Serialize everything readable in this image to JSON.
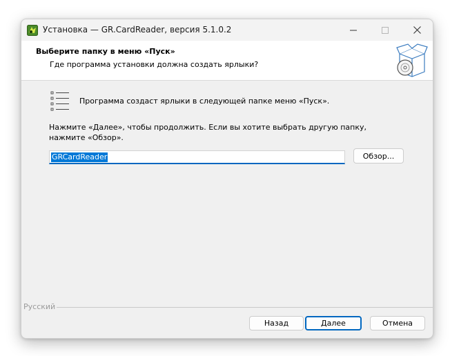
{
  "window": {
    "title": "Установка — GR.CardReader, версия 5.1.0.2"
  },
  "header": {
    "title": "Выберите папку в меню «Пуск»",
    "subtitle": "Где программа установки должна создать ярлыки?"
  },
  "body": {
    "info": "Программа создаст ярлыки в следующей папке меню «Пуск».",
    "instruction": "Нажмите «Далее», чтобы продолжить. Если вы хотите выбрать другую папку, нажмите «Обзор».",
    "folder_value": "GRCardReader",
    "browse_label": "Обзор..."
  },
  "footer": {
    "language": "Русский",
    "back_label": "Назад",
    "next_label": "Далее",
    "cancel_label": "Отмена"
  },
  "colors": {
    "accent": "#0067c0",
    "selection": "#0078d7",
    "background": "#f0f0f0"
  }
}
